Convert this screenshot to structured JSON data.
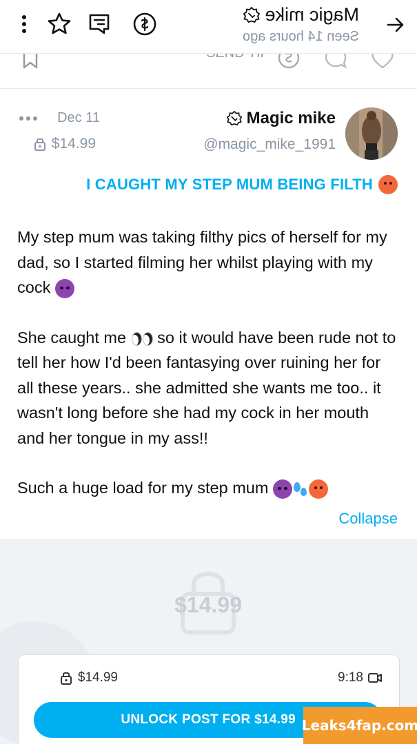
{
  "header": {
    "chat_title": "Magic mike",
    "status": "Seen  14 hours ago",
    "icons": [
      "back-arrow-icon",
      "dollar-tip-icon",
      "note-icon",
      "star-icon",
      "kebab-menu-icon"
    ]
  },
  "ghost_row": {
    "send_tip_label": "SEND TIP"
  },
  "post": {
    "author_name": "Magic mike",
    "author_handle": "@magic_mike_1991",
    "date": "Dec 11",
    "price": "$14.99",
    "title": "I CAUGHT MY STEP MUM BEING FILTH",
    "paragraphs": [
      "My step mum was taking filthy pics of herself for my dad, so I started filming her whilst playing with my cock",
      "She caught me",
      "so it would have been rude not to tell her how I'd been fantasying over ruining her for all these years.. she admitted she wants me too.. it wasn't long before she had my cock in her mouth and her tongue in my ass!!",
      "Such a huge load for my step mum"
    ],
    "collapse_label": "Collapse"
  },
  "locked": {
    "price": "$14.99",
    "duration": "9:18",
    "card_price": "$14.99",
    "unlock_label": "UNLOCK POST FOR $14.99"
  },
  "watermark": "Leaks4fap.com",
  "colors": {
    "accent": "#00aff0",
    "muted": "#8a96a3",
    "locked_bg": "#f0f3f6",
    "watermark_bg": "#f39a2e"
  }
}
